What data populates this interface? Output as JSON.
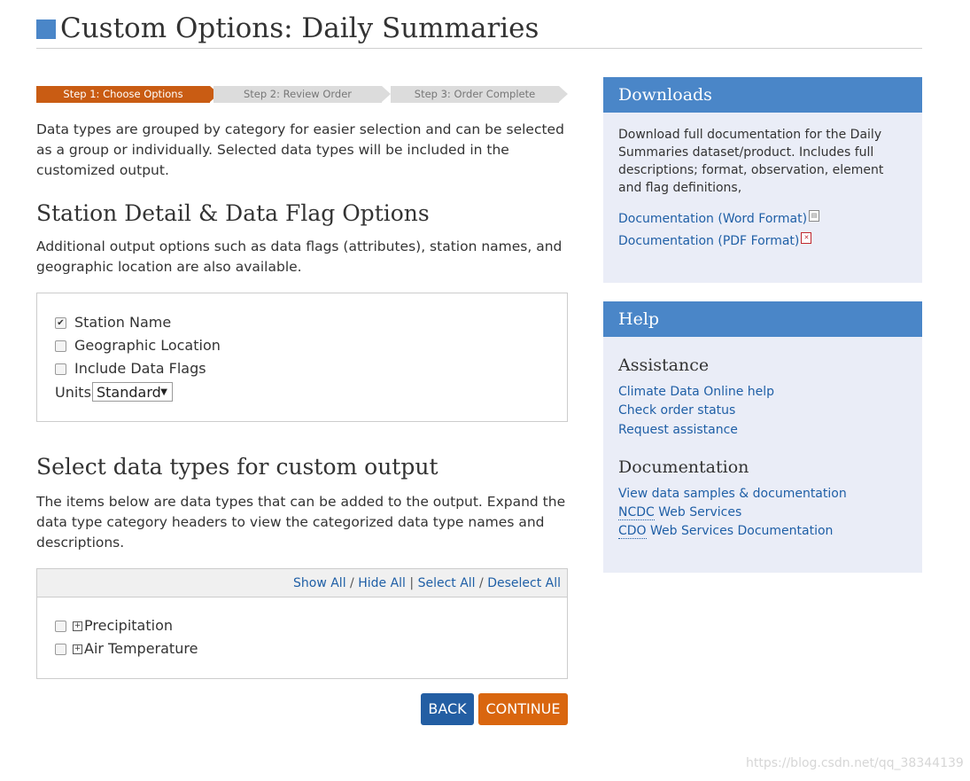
{
  "page": {
    "title": "Custom Options: Daily Summaries"
  },
  "steps": [
    "Step 1: Choose Options",
    "Step 2: Review Order",
    "Step 3: Order Complete"
  ],
  "intro": "Data types are grouped by category for easier selection and can be selected as a group or individually. Selected data types will be included in the customized output.",
  "station_section": {
    "heading": "Station Detail & Data Flag Options",
    "description": "Additional output options such as data flags (attributes), station names, and geographic location are also available.",
    "options": [
      {
        "label": "Station Name",
        "checked": true
      },
      {
        "label": "Geographic Location",
        "checked": false
      },
      {
        "label": "Include Data Flags",
        "checked": false
      }
    ],
    "units_label": "Units",
    "units_value": "Standard"
  },
  "datatype_section": {
    "heading": "Select data types for custom output",
    "description": "The items below are data types that can be added to the output. Expand the data type category headers to view the categorized data type names and descriptions.",
    "toolbar": {
      "show_all": "Show All",
      "hide_all": "Hide All",
      "select_all": "Select All",
      "deselect_all": "Deselect All"
    },
    "categories": [
      "Precipitation",
      "Air Temperature"
    ]
  },
  "buttons": {
    "back": "BACK",
    "continue": "CONTINUE"
  },
  "downloads": {
    "title": "Downloads",
    "text": "Download full documentation for the Daily Summaries dataset/product. Includes full descriptions; format, observation, element and flag definitions,",
    "word_link": "Documentation (Word Format)",
    "pdf_link": "Documentation (PDF Format)"
  },
  "help": {
    "title": "Help",
    "assistance_heading": "Assistance",
    "assistance_links": [
      "Climate Data Online help",
      "Check order status",
      "Request assistance"
    ],
    "documentation_heading": "Documentation",
    "doc_link_1": "View data samples & documentation",
    "doc_link_2_abbr": "NCDC",
    "doc_link_2_rest": " Web Services",
    "doc_link_3_abbr": "CDO",
    "doc_link_3_rest": " Web Services Documentation"
  },
  "watermark": "https://blog.csdn.net/qq_38344139",
  "colors": {
    "accent_blue": "#4a86c8",
    "step_active": "#c95c13",
    "back_button": "#235ea3",
    "continue_button": "#d9660f",
    "panel_bg": "#eaedf7"
  }
}
